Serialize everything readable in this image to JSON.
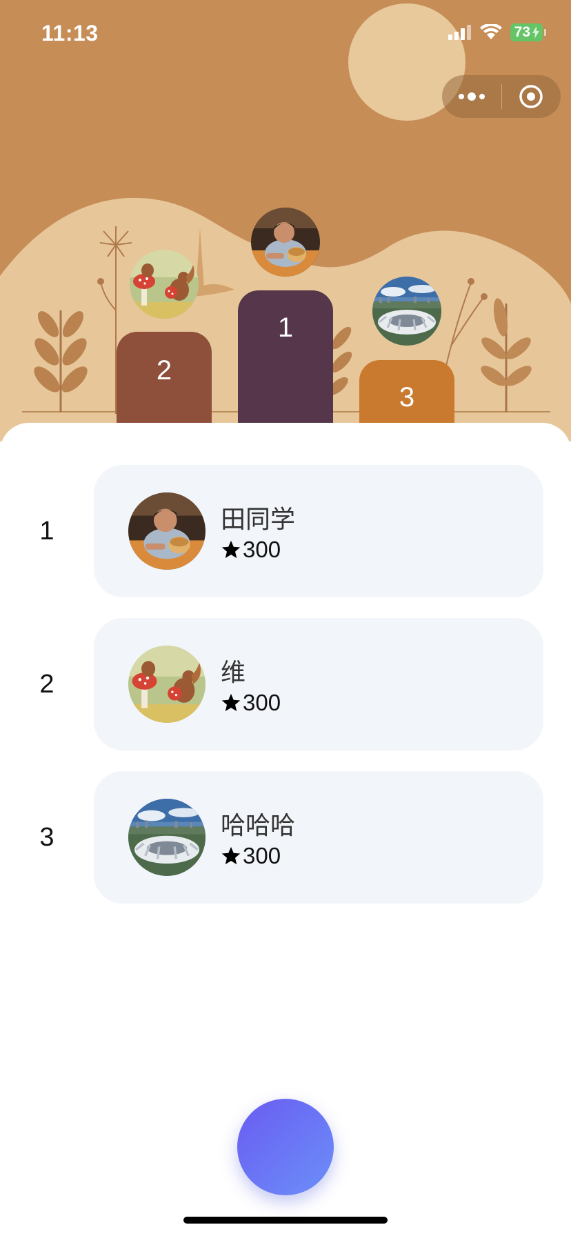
{
  "status_bar": {
    "time": "11:13",
    "battery": "73"
  },
  "capsule": {
    "more_icon": "more-dots-icon",
    "close_icon": "record-circle-icon"
  },
  "podium": [
    {
      "rank": "2",
      "avatar": "squirrel-mushroom-photo"
    },
    {
      "rank": "1",
      "avatar": "boy-with-bread-photo"
    },
    {
      "rank": "3",
      "avatar": "stadium-photo"
    }
  ],
  "leaderboard": [
    {
      "rank": "1",
      "name": "田同学",
      "score": "300",
      "avatar": "boy-with-bread-photo"
    },
    {
      "rank": "2",
      "name": "维",
      "score": "300",
      "avatar": "squirrel-mushroom-photo"
    },
    {
      "rank": "3",
      "name": "哈哈哈",
      "score": "300",
      "avatar": "stadium-photo"
    }
  ],
  "colors": {
    "hero_background": "#c68d57",
    "hill": "#e7c79a",
    "podium_first": "#55364a",
    "podium_second": "#8e503a",
    "podium_third": "#c97a2e",
    "card_background": "#f2f5f9",
    "fab_gradient_start": "#6a5cf2",
    "fab_gradient_end": "#6b8ff8"
  }
}
